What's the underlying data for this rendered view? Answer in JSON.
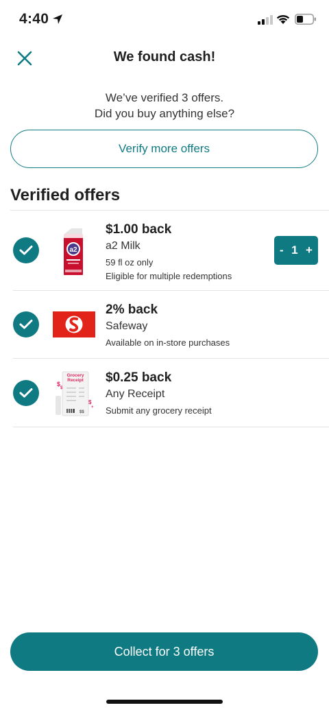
{
  "status_bar": {
    "time": "4:40"
  },
  "header": {
    "close_icon": "close-x",
    "title": "We found cash!"
  },
  "subtitle": {
    "line1": "We’ve verified 3 offers.",
    "line2": "Did you buy anything else?"
  },
  "verify_button": {
    "label": "Verify more offers"
  },
  "section": {
    "title": "Verified offers"
  },
  "offers": [
    {
      "amount": "$1.00 back",
      "name": "a2 Milk",
      "detail1": "59 fl oz only",
      "detail2": "Eligible for multiple redemptions",
      "icon": "milk-carton",
      "quantity": {
        "minus": "-",
        "value": "1",
        "plus": "+"
      }
    },
    {
      "amount": "2% back",
      "name": "Safeway",
      "detail1": "Available on in-store purchases",
      "icon": "safeway-logo"
    },
    {
      "amount": "$0.25 back",
      "name": "Any Receipt",
      "detail1": "Submit any grocery receipt",
      "icon": "receipt",
      "thumb_text": "Grocery Receipt"
    }
  ],
  "collect_button": {
    "label": "Collect for 3 offers"
  },
  "colors": {
    "accent": "#0f7a82",
    "safeway_red": "#e2231a",
    "milk_red": "#c8102e"
  }
}
